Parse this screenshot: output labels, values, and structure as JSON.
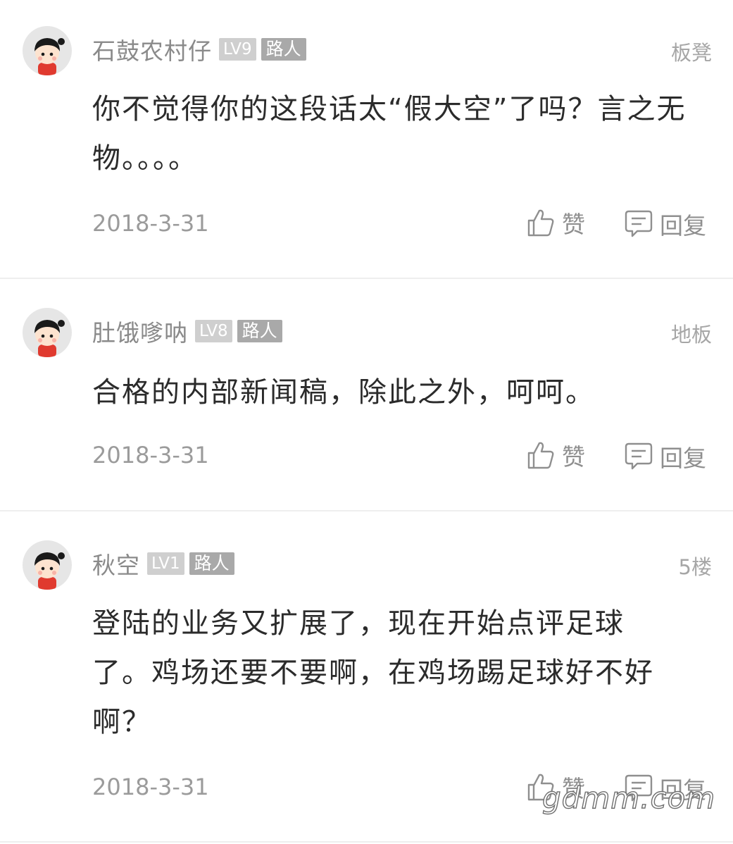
{
  "comments": [
    {
      "username": "石鼓农村仔",
      "level": "LV9",
      "role": "路人",
      "floor": "板凳",
      "content": "你不觉得你的这段话太“假大空”了吗？言之无物。。。。",
      "date": "2018-3-31",
      "like_label": "赞",
      "reply_label": "回复"
    },
    {
      "username": "肚饿嗲呐",
      "level": "LV8",
      "role": "路人",
      "floor": "地板",
      "content": "合格的内部新闻稿，除此之外，呵呵。",
      "date": "2018-3-31",
      "like_label": "赞",
      "reply_label": "回复"
    },
    {
      "username": "秋空",
      "level": "LV1",
      "role": "路人",
      "floor": "5楼",
      "content": "登陆的业务又扩展了，现在开始点评足球了。鸡场还要不要啊，在鸡场踢足球好不好啊？",
      "date": "2018-3-31",
      "like_label": "赞",
      "reply_label": "回复"
    }
  ],
  "watermark": "gdmm.com",
  "colors": {
    "username": "#8a8a8a",
    "content": "#2b2b2b",
    "meta": "#9b9b9b",
    "level_badge": "#cfcfcf",
    "role_badge": "#a9a9a9",
    "divider": "#eeeeee"
  },
  "icons": {
    "avatar": "cartoon-child-avatar",
    "like": "thumbs-up-icon",
    "reply": "speech-bubble-icon"
  }
}
